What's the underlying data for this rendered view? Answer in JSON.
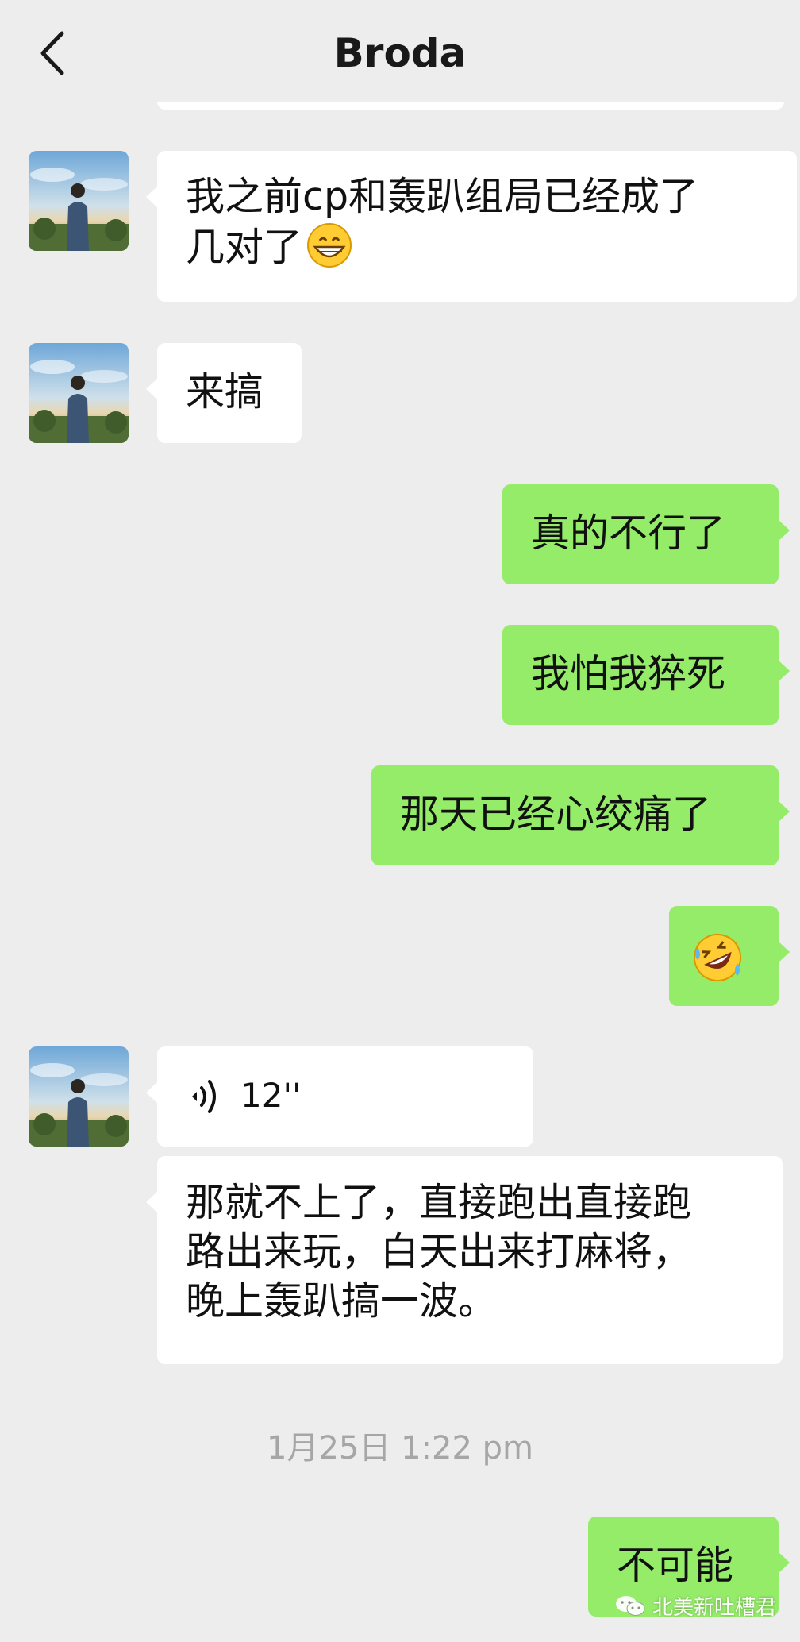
{
  "header": {
    "title": "Broda",
    "back_icon": "chevron-left-icon"
  },
  "messages": [
    {
      "side": "in",
      "text": "我之前cp和轰趴组局已经成了\n几对了",
      "emoji": "grinning-face-icon"
    },
    {
      "side": "in",
      "text": "来搞"
    },
    {
      "side": "out",
      "text": "真的不行了"
    },
    {
      "side": "out",
      "text": "我怕我猝死"
    },
    {
      "side": "out",
      "text": "那天已经心绞痛了"
    },
    {
      "side": "out",
      "text": "",
      "emoji": "rolling-laughing-face-icon"
    },
    {
      "side": "in",
      "voice_duration": "12''"
    },
    {
      "side": "in",
      "text": "那就不上了，直接跑出直接跑\n路出来玩，白天出来打麻将，\n晚上轰趴搞一波。"
    },
    {
      "side": "out",
      "text": "不可能"
    }
  ],
  "timestamp": "1月25日 1:22 pm",
  "watermark": {
    "text": "北美新吐槽君",
    "icon": "wechat-icon"
  },
  "colors": {
    "background": "#ededed",
    "incoming": "#ffffff",
    "outgoing": "#95ec69",
    "timestamp": "#a6a6a6"
  }
}
